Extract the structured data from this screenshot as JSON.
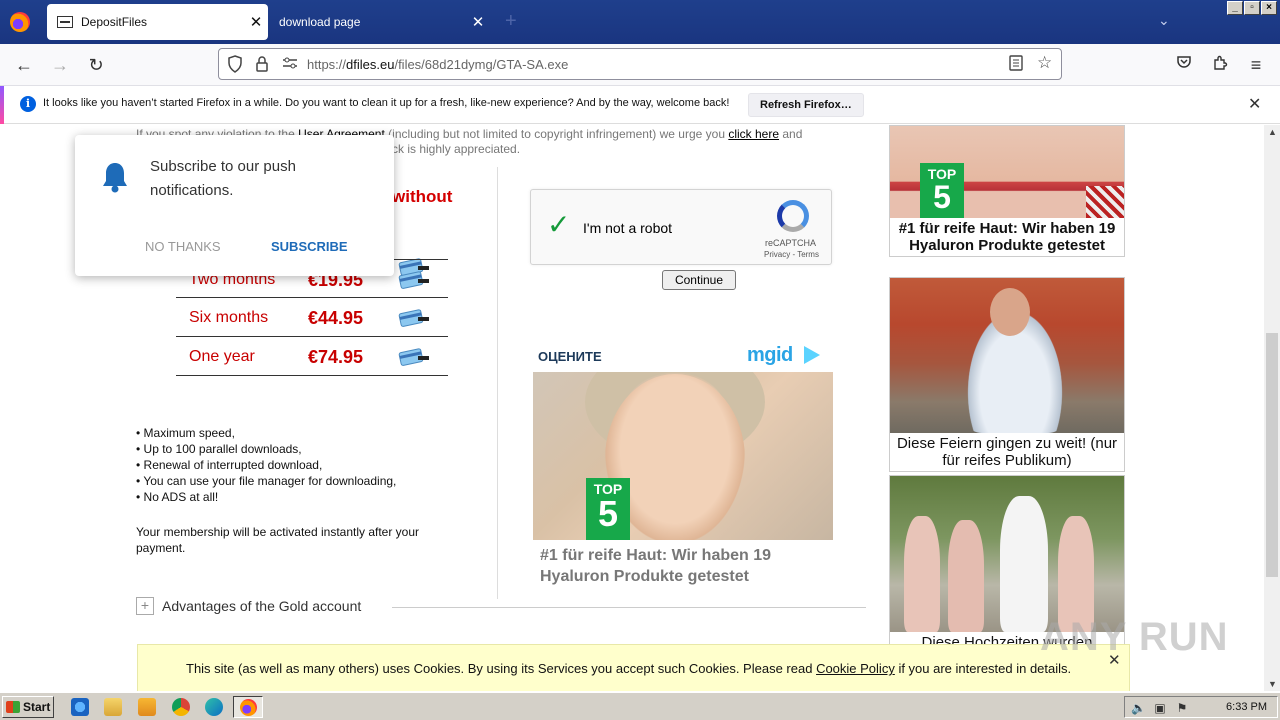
{
  "browser": {
    "tabs": [
      {
        "label": "DepositFiles",
        "active": true
      },
      {
        "label": "download page",
        "active": false
      }
    ],
    "url": {
      "prefix": "https://",
      "domain": "dfiles.eu",
      "path": "/files/68d21dymg/GTA-SA.exe"
    },
    "window_buttons": [
      "_",
      "▫",
      "×"
    ]
  },
  "notification_bar": {
    "message": "It looks like you haven’t started Firefox in a while. Do you want to clean it up for a fresh, like-new experience? And by the way, welcome back!",
    "button": "Refresh Firefox…"
  },
  "page": {
    "top_text": {
      "line1_prefix": "If you spot any violation to the ",
      "link_user_agreement": "User Agreement",
      "line1_mid": " (including but not limited to copyright infringement) we urge you ",
      "link_click_here": "click here",
      "line1_suffix": " and",
      "line2": "ck is highly appreciated."
    },
    "without_heading": "without",
    "pricing": [
      {
        "period": "Two months",
        "price": "€19.95"
      },
      {
        "period": "Six months",
        "price": "€44.95"
      },
      {
        "period": "One year",
        "price": "€74.95"
      }
    ],
    "features": [
      "• Maximum speed,",
      "• Up to 100 parallel downloads,",
      "• Renewal of interrupted download,",
      "• You can use your file manager for downloading,",
      "• No ADS at all!"
    ],
    "activation_text": "Your membership will be activated instantly after your payment.",
    "advantages_label": "Advantages of the Gold account",
    "recaptcha": {
      "label": "I'm not a robot",
      "brand": "reCAPTCHA",
      "links": "Privacy - Terms"
    },
    "continue_button": "Continue",
    "mgid": {
      "header": "ОЦЕНИТЕ",
      "logo": "mgid",
      "top5_top": "TOP",
      "top5_num": "5",
      "ad_title": "#1 für reife Haut: Wir haben 19 Hyaluron Produkte getestet"
    },
    "side_ads": [
      {
        "caption": "#1 für reife Haut: Wir haben 19 Hyaluron Produkte getestet",
        "top5_top": "TOP",
        "top5_num": "5"
      },
      {
        "caption": "Diese Feiern gingen zu weit! (nur für reifes Publikum)"
      },
      {
        "caption": "Diese Hochzeiten wurden"
      }
    ],
    "push_popup": {
      "text": "Subscribe to our push notifications.",
      "no_thanks": "NO THANKS",
      "subscribe": "SUBSCRIBE"
    },
    "cookie_bar": {
      "prefix": "This site (as well as many others) uses Cookies. By using its Services you accept such Cookies. Please read ",
      "link": "Cookie Policy",
      "suffix": " if you are interested in details.",
      "close": "✕"
    },
    "watermark": "ANY RUN"
  },
  "taskbar": {
    "start_label": "Start",
    "clock": "6:33 PM"
  },
  "colors": {
    "price_red": "#c80000",
    "heading_red": "#d40000",
    "tabbar_blue": "#1d3b87",
    "cookie_bg": "#ffffcc",
    "subscribe_blue": "#1e6bb8"
  }
}
